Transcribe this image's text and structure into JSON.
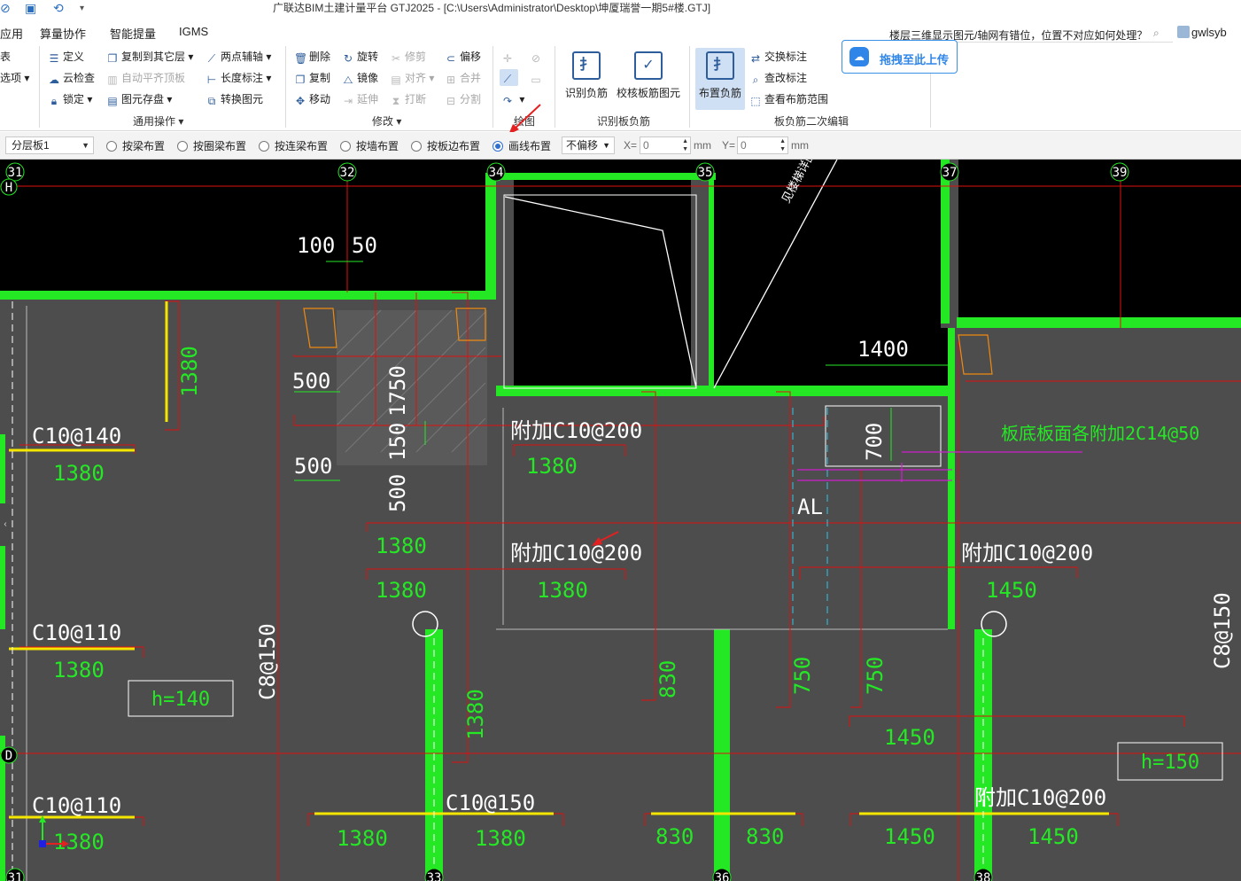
{
  "window": {
    "title": "广联达BIM土建计量平台 GTJ2025 - [C:\\Users\\Administrator\\Desktop\\坤厦瑞誉一期5#楼.GTJ]"
  },
  "menu": {
    "items": [
      "应用",
      "算量协作",
      "智能提量",
      "IGMS"
    ],
    "help_question": "楼层三维显示图元/轴网有错位，位置不对应如何处理？",
    "user": "gwlsyb"
  },
  "ribbon": {
    "left_partial": [
      "表",
      "选项"
    ],
    "general": {
      "label": "通用操作",
      "define": "定义",
      "cloud_check": "云检查",
      "lock": "锁定",
      "copy_to_floor": "复制到其它层",
      "auto_flat_roof": "自动平齐顶板",
      "element_store": "图元存盘",
      "two_point_axis": "两点辅轴",
      "length_dim": "长度标注",
      "convert_element": "转换图元"
    },
    "modify": {
      "label": "修改",
      "delete": "删除",
      "copy": "复制",
      "move": "移动",
      "rotate": "旋转",
      "mirror": "镜像",
      "extend": "延伸",
      "trim": "修剪",
      "align": "对齐",
      "break": "打断",
      "offset": "偏移",
      "merge": "合并",
      "split": "分割"
    },
    "draw": {
      "label": "绘图"
    },
    "identify": {
      "label": "识别板负筋",
      "identify_neg": "识别负筋",
      "check_neg": "校核板筋图元"
    },
    "second_edit": {
      "label": "板负筋二次编辑",
      "place_neg": "布置负筋",
      "swap_dim": "交换标注",
      "view_change": "查改标注",
      "view_range": "查看布筋范围"
    },
    "upload": "拖拽至此上传"
  },
  "options": {
    "floor_slab": "分层板1",
    "radios": [
      "按梁布置",
      "按圈梁布置",
      "按连梁布置",
      "按墙布置",
      "按板边布置",
      "画线布置"
    ],
    "selected_radio": "画线布置",
    "offset_mode": "不偏移",
    "x_label": "X=",
    "x_value": "0",
    "y_label": "Y=",
    "y_value": "0",
    "unit": "mm"
  },
  "cad": {
    "axes_top": [
      "31",
      "32",
      "34",
      "35",
      "37",
      "39"
    ],
    "axes_bottom": [
      "31",
      "33",
      "36",
      "38"
    ],
    "axis_letters": [
      "H",
      "D"
    ],
    "dims": {
      "d100": "100",
      "d50": "50",
      "d500a": "500",
      "d1750": "1750",
      "d150": "150",
      "d500b": "500",
      "d500c": "500",
      "d1400": "1400",
      "d700": "700",
      "d830a": "830",
      "d750a": "750",
      "d750b": "750",
      "d1450a": "1450",
      "d830b": "830",
      "d830c": "830",
      "d1450b": "1450",
      "d1450c": "1450",
      "d1380v": "1380",
      "d1380v2": "1380"
    },
    "rebar_labels": {
      "c10_140": "C10@140",
      "c10_110a": "C10@110",
      "c10_110b": "C10@110",
      "c10_200a": "附加C10@200",
      "c10_200b": "附加C10@200",
      "c10_200c": "附加C10@200",
      "c10_200d": "附加C10@200",
      "c10_150": "C10@150",
      "c8_150": "C8@150",
      "c8_150b": "C8@150",
      "c14_50": "板底板面各附加2C14@50",
      "slanted": "见楼梯详图"
    },
    "len_1380": "1380",
    "len_1450": "1450",
    "al": "AL",
    "h140": "h=140",
    "h150": "h=150"
  },
  "colors": {
    "wall_green": "#25e825",
    "slab_gray": "#4d4d4d",
    "red_line": "#e01010",
    "rebar_yellow": "#f5e600",
    "accent_blue": "#2f86e8"
  }
}
